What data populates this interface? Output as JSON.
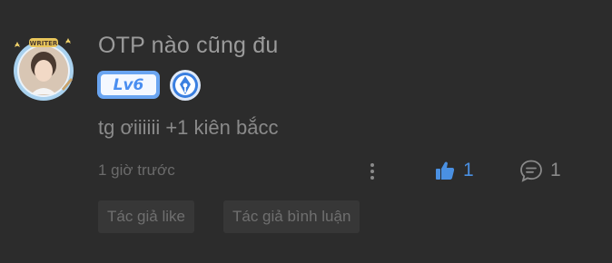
{
  "comment": {
    "username": "OTP nào cũng đu",
    "level_badge": "Lv6",
    "avatar_frame_text": "WRITER",
    "text": "tg ơiiiiii +1 kiên bắcc",
    "time": "1 giờ trước",
    "likes": "1",
    "replies": "1",
    "tags": [
      "Tác giả like",
      "Tác giả bình luận"
    ]
  },
  "colors": {
    "background": "#2c2c2c",
    "accent_blue": "#4a90e2",
    "level_badge_bg": "#6aa5f1",
    "muted_text": "#8a8a8a",
    "tag_bg": "#373737"
  },
  "icons": [
    "avatar",
    "writer-medal-icon",
    "more-options-icon",
    "thumbs-up-icon",
    "comment-bubble-icon"
  ]
}
